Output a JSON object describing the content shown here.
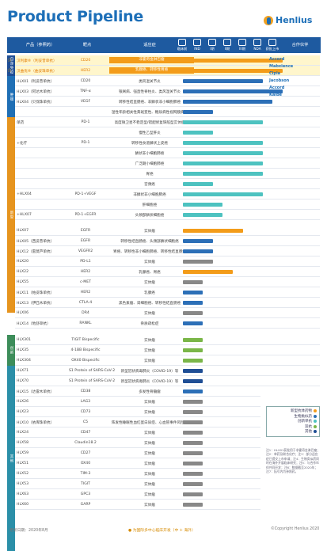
{
  "title": "Product Pipeline",
  "brand": "Henlius",
  "header": {
    "product": "产品（参照药）",
    "target": "靶点",
    "indication": "适应症",
    "phases": [
      "临床前",
      "IND",
      "I期",
      "II期",
      "III期",
      "NDA",
      "获批上市"
    ],
    "partner": "合作伙伴"
  },
  "categories": [
    {
      "label": "自身免疫",
      "color": "#1f4e95"
    },
    {
      "label": "肿瘤",
      "color": "#1f6fb5"
    },
    {
      "label": "新型",
      "color": "#e6941e"
    },
    {
      "label": "创新",
      "color": "#3d8d5a"
    },
    {
      "label": "其他",
      "color": "#2b8fa8"
    }
  ],
  "rows": [
    {
      "p": "汉利康®（利妥昔单抗）",
      "t": "CD20",
      "ind": "非霍奇金淋巴瘤",
      "bar": "#f39c1a",
      "w": 1,
      "hl": true
    },
    {
      "p": "汉曲优®（曲妥珠单抗）",
      "t": "HER2",
      "ind": "乳腺癌、转移性胃癌",
      "bar": "#f39c1a",
      "w": 1,
      "hl": true
    },
    {
      "p": "HLX01（利妥昔单抗）",
      "t": "CD20",
      "ind": "类风湿关节炎",
      "bar": "#2c6fb7",
      "w": 0.8
    },
    {
      "p": "HLX03（阿达木单抗）",
      "t": "TNF-α",
      "ind": "银屑病、强直性脊柱炎、类风湿关节炎",
      "bar": "#2c6fb7",
      "w": 1
    },
    {
      "p": "HLX04（贝伐珠单抗）",
      "t": "VEGF",
      "ind": "转移性结直肠癌、非鳞状非小细胞肺癌",
      "bar": "#2c6fb7",
      "w": 0.9
    },
    {
      "p": "",
      "t": "",
      "ind": "湿性年龄相关性黄斑变性、糖尿病性视网膜病变",
      "bar": "#2c6fb7",
      "w": 0.3
    },
    {
      "p": "单药",
      "t": "PD-1",
      "ind": "高度微卫星不稳定型/错配修复缺陷型实体瘤",
      "bar": "#4dc2c0",
      "w": 0.8
    },
    {
      "p": "",
      "t": "",
      "ind": "慢性乙型肝炎",
      "bar": "#4dc2c0",
      "w": 0.3
    },
    {
      "p": "+化疗",
      "t": "PD-1",
      "ind": "转移性食道鳞状上皮癌",
      "bar": "#4dc2c0",
      "w": 0.8
    },
    {
      "p": "",
      "t": "",
      "ind": "鳞状非小细胞肺癌",
      "bar": "#4dc2c0",
      "w": 0.8
    },
    {
      "p": "",
      "t": "",
      "ind": "广泛期小细胞肺癌",
      "bar": "#4dc2c0",
      "w": 0.8
    },
    {
      "p": "",
      "t": "",
      "ind": "胃癌",
      "bar": "#4dc2c0",
      "w": 0.8
    },
    {
      "p": "",
      "t": "",
      "ind": "宫颈癌",
      "bar": "#4dc2c0",
      "w": 0.3
    },
    {
      "p": "+HLX04",
      "t": "PD-1+VEGF",
      "ind": "非鳞状非小细胞肺癌",
      "bar": "#4dc2c0",
      "w": 0.8
    },
    {
      "p": "",
      "t": "",
      "ind": "肝细胞癌",
      "bar": "#4dc2c0",
      "w": 0.4
    },
    {
      "p": "+HLX07",
      "t": "PD-1+EGFR",
      "ind": "头颈部鳞状细胞癌",
      "bar": "#4dc2c0",
      "w": 0.4
    },
    {
      "p": "HLX07",
      "t": "EGFR",
      "ind": "实体瘤",
      "bar": "#f39c1a",
      "w": 0.6
    },
    {
      "p": "HLX05（西妥昔单抗）",
      "t": "EGFR",
      "ind": "转移性结直肠癌、头颈部鳞状细胞癌",
      "bar": "#2c6fb7",
      "w": 0.3
    },
    {
      "p": "HLX12（雷莫芦单抗）",
      "t": "VEGFR2",
      "ind": "胃癌、转移性非小细胞肺癌、转移性结直肠癌",
      "bar": "#2c6fb7",
      "w": 0.3
    },
    {
      "p": "HLX20",
      "t": "PD-L1",
      "ind": "实体瘤",
      "bar": "#888",
      "w": 0.3
    },
    {
      "p": "HLX22",
      "t": "HER2",
      "ind": "乳腺癌、胃癌",
      "bar": "#f39c1a",
      "w": 0.5
    },
    {
      "p": "HLX55",
      "t": "c-MET",
      "ind": "实体瘤",
      "bar": "#888",
      "w": 0.2
    },
    {
      "p": "HLX11（帕妥珠单抗）",
      "t": "HER2",
      "ind": "乳腺癌",
      "bar": "#2c6fb7",
      "w": 0.2
    },
    {
      "p": "HLX13（伊匹木单抗）",
      "t": "CTLA-4",
      "ind": "黑色素瘤、肾细胞癌、转移性结直肠癌",
      "bar": "#2c6fb7",
      "w": 0.2
    },
    {
      "p": "HLX06",
      "t": "DR4",
      "ind": "实体瘤",
      "bar": "#888",
      "w": 0.2
    },
    {
      "p": "HLX14（地舒单抗）",
      "t": "RANKL",
      "ind": "骨质疏松症",
      "bar": "#2c6fb7",
      "w": 0.2
    },
    {
      "p": "HLX301",
      "t": "TIGIT Bispecific",
      "ind": "实体瘤",
      "bar": "#7ab648",
      "w": 0.2
    },
    {
      "p": "HLX35",
      "t": "4-1BB Bispecific",
      "ind": "实体瘤",
      "bar": "#7ab648",
      "w": 0.2
    },
    {
      "p": "HLX304",
      "t": "OX40 Bispecific",
      "ind": "实体瘤",
      "bar": "#7ab648",
      "w": 0.2
    },
    {
      "p": "HLX71",
      "t": "S1 Protein of SARS-CoV-2",
      "ind": "新型冠状病毒肺炎（COVID-19）等",
      "bar": "#1f4e95",
      "w": 0.2
    },
    {
      "p": "HLX70",
      "t": "S1 Protein of SARS-CoV-2",
      "ind": "新型冠状病毒肺炎（COVID-19）等",
      "bar": "#1f4e95",
      "w": 0.2
    },
    {
      "p": "HLX15（达雷木单抗）",
      "t": "CD38",
      "ind": "多发性骨髓瘤",
      "bar": "#2c6fb7",
      "w": 0.2
    },
    {
      "p": "HLX26",
      "t": "LAG3",
      "ind": "实体瘤",
      "bar": "#888",
      "w": 0.2
    },
    {
      "p": "HLX23",
      "t": "CD73",
      "ind": "实体瘤",
      "bar": "#888",
      "w": 0.2
    },
    {
      "p": "HLX10（依库珠单抗）",
      "t": "C5",
      "ind": "阵发性睡眠性血红蛋白尿症、心血管事件风险等",
      "bar": "#888",
      "w": 0.2
    },
    {
      "p": "HLX24",
      "t": "CD47",
      "ind": "实体瘤",
      "bar": "#888",
      "w": 0.2
    },
    {
      "p": "HLX58",
      "t": "Claudin18.2",
      "ind": "实体瘤",
      "bar": "#888",
      "w": 0.2
    },
    {
      "p": "HLX59",
      "t": "CD27",
      "ind": "实体瘤",
      "bar": "#888",
      "w": 0.2
    },
    {
      "p": "HLX51",
      "t": "OX40",
      "ind": "实体瘤",
      "bar": "#888",
      "w": 0.2
    },
    {
      "p": "HLX52",
      "t": "TIM-3",
      "ind": "实体瘤",
      "bar": "#888",
      "w": 0.2
    },
    {
      "p": "HLX53",
      "t": "TIGIT",
      "ind": "实体瘤",
      "bar": "#888",
      "w": 0.2
    },
    {
      "p": "HLX63",
      "t": "GPC3",
      "ind": "实体瘤",
      "bar": "#888",
      "w": 0.2
    },
    {
      "p": "HLX60",
      "t": "GARP",
      "ind": "实体瘤",
      "bar": "#888",
      "w": 0.2
    }
  ],
  "legend": [
    {
      "label": "新型抗体药物",
      "color": "#f39c1a"
    },
    {
      "label": "生物类似药",
      "color": "#2c6fb7"
    },
    {
      "label": "创新单抗",
      "color": "#4dc2c0"
    },
    {
      "label": "双抗",
      "color": "#7ab648"
    },
    {
      "label": "其他",
      "color": "#1f4e95"
    }
  ],
  "partners": [
    "Accord",
    "Mabxience",
    "Cipla",
    "Jacobson",
    "Accord",
    "Kalbe"
  ],
  "notes": "注1：HLX01获批用于非霍奇金淋巴瘤；注2：单药及联合化疗；注3：部分适应症已提交上市申请；注4：生物类似药同时在海外开展临床研究；注5：与合作伙伴共同开发；注6：数据截至2020年；注7：括号内为参照药。",
  "footer": {
    "date": "更新日期：2020年8月",
    "note": "● 为国际多中心临床开发（中 + 海外）",
    "copy": "©Copyright Henlius 2020"
  }
}
